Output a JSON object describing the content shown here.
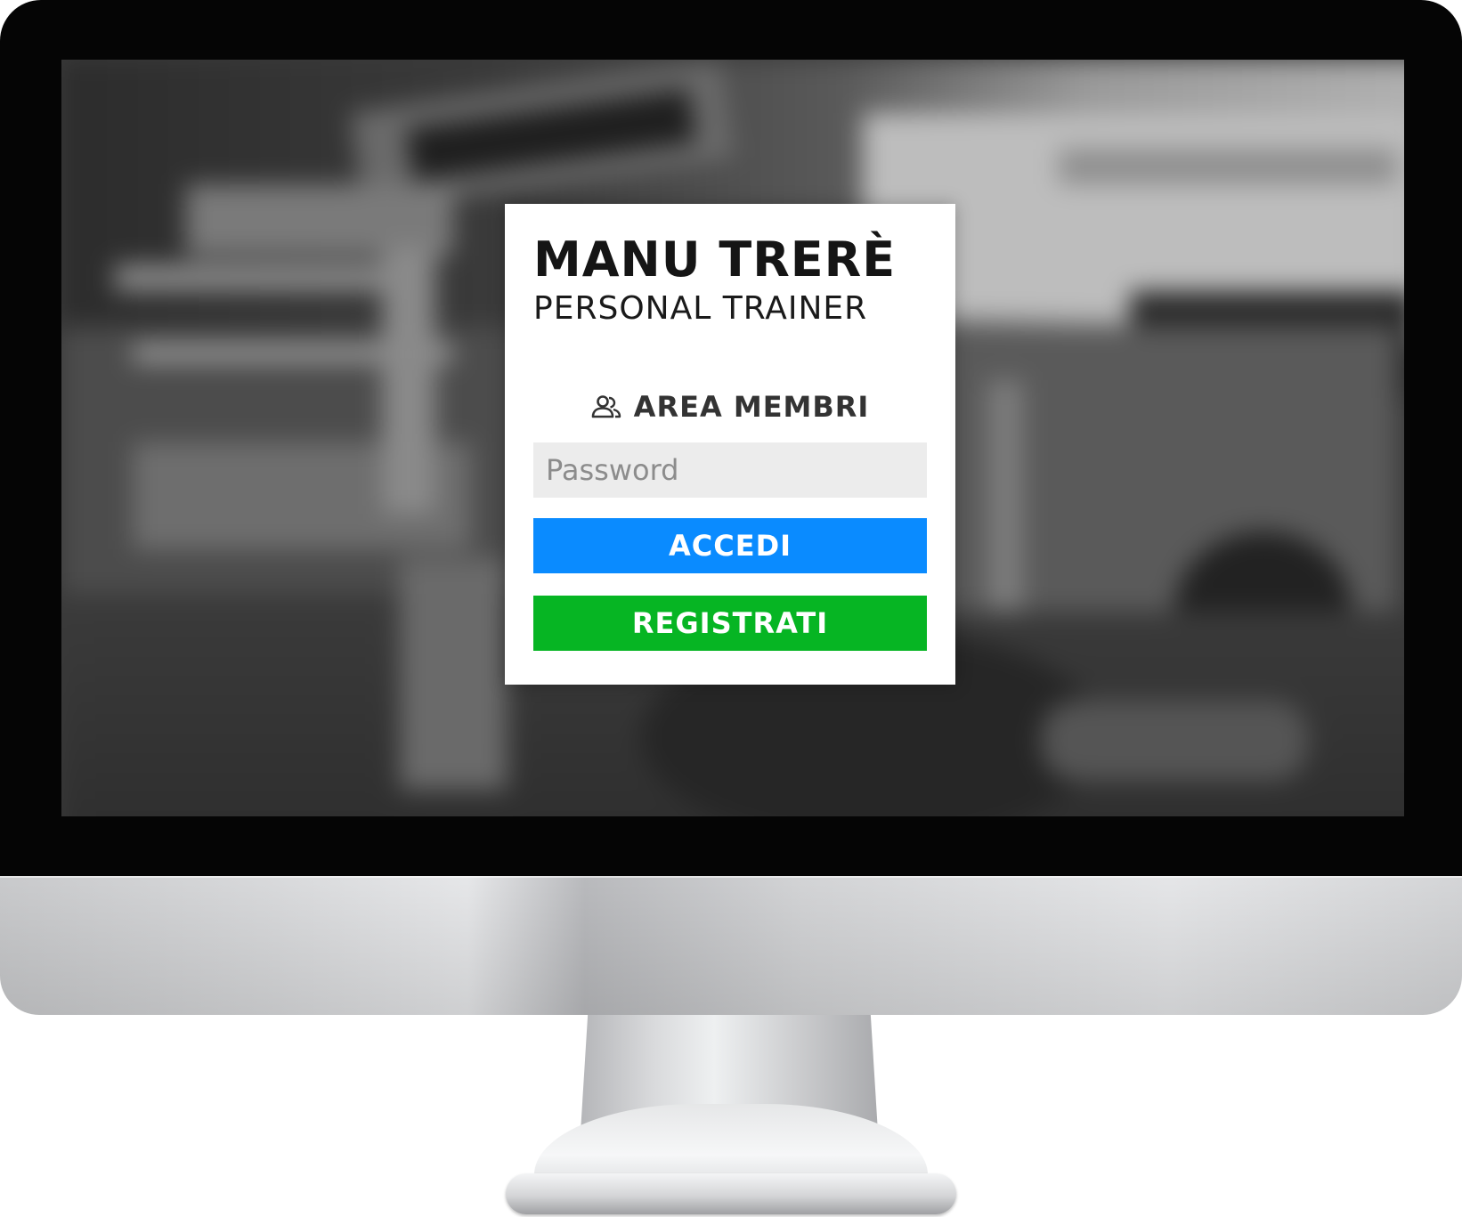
{
  "brand": {
    "title": "MANU TRERÈ",
    "subtitle": "PERSONAL TRAINER"
  },
  "login": {
    "section_icon": "users-icon",
    "section_title": "AREA MEMBRI",
    "password_placeholder": "Password",
    "password_value": "",
    "login_button": "ACCEDI",
    "register_button": "REGISTRATI"
  },
  "colors": {
    "login_button": "#0a8bff",
    "register_button": "#06b523",
    "input_background": "#ececec",
    "card_background": "#ffffff"
  }
}
